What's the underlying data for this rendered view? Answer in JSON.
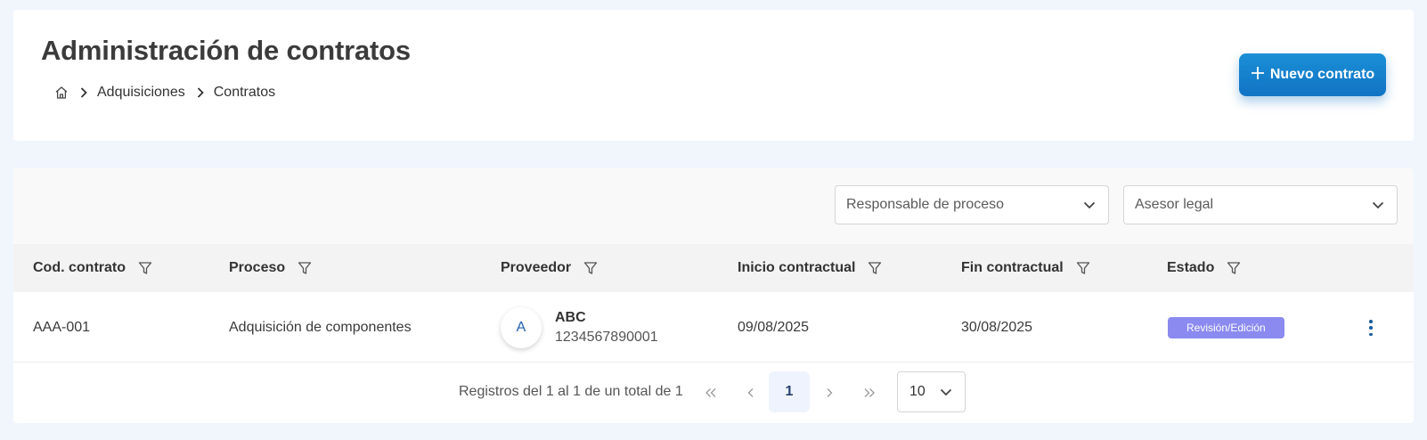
{
  "header": {
    "title": "Administración de contratos",
    "breadcrumb": [
      "Adquisiciones",
      "Contratos"
    ],
    "new_button_label": "Nuevo contrato"
  },
  "filters": {
    "responsable_placeholder": "Responsable de proceso",
    "asesor_placeholder": "Asesor legal"
  },
  "table": {
    "columns": [
      "Cod. contrato",
      "Proceso",
      "Proveedor",
      "Inicio contractual",
      "Fin contractual",
      "Estado"
    ],
    "rows": [
      {
        "codigo": "AAA-001",
        "proceso": "Adquisición de componentes",
        "proveedor_inicial": "A",
        "proveedor_nombre": "ABC",
        "proveedor_id": "1234567890001",
        "inicio": "09/08/2025",
        "fin": "30/08/2025",
        "estado": "Revisión/Edición"
      }
    ]
  },
  "pagination": {
    "info": "Registros del 1 al 1 de un total de 1",
    "first": "«",
    "prev": "‹",
    "current_page": "1",
    "next": "›",
    "last": "»",
    "page_size": "10"
  },
  "colors": {
    "primary": "#1a8fd6",
    "badge": "#8a8af0",
    "background": "#f1f6fd"
  },
  "icons": {
    "home": "home-icon",
    "separator": "chevron-right-icon",
    "filter": "filter-icon",
    "dropdown": "chevron-down-icon",
    "row_menu": "kebab-icon"
  }
}
